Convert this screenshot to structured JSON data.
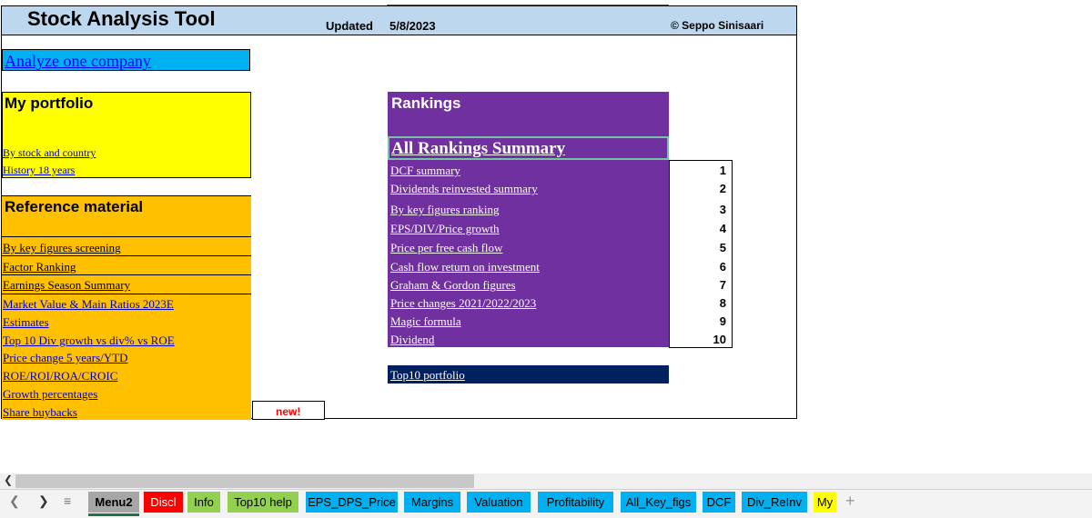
{
  "header": {
    "title": "Stock Analysis Tool",
    "updated_label": "Updated",
    "updated_date": "5/8/2023",
    "copyright": "© Seppo Sinisaari"
  },
  "analyze_link": "Analyze one company",
  "portfolio": {
    "title": "My portfolio",
    "links": [
      "By stock and country",
      "History 18 years"
    ]
  },
  "reference": {
    "title": "Reference material",
    "links": [
      "By key figures screening",
      "Factor Ranking",
      "Earnings Season Summary",
      "Market Value & Main Ratios 2023E",
      "Estimates",
      "Top 10 Div growth vs div% vs ROE",
      "Price change 5 years/YTD",
      "ROE/ROI/ROA/CROIC",
      "Growth  percentages",
      "Share buybacks"
    ],
    "new_label": "new!"
  },
  "rankings": {
    "title": "Rankings",
    "summary": "All Rankings Summary",
    "items": [
      {
        "label": "DCF summary",
        "num": "1"
      },
      {
        "label": "Dividends reinvested summary",
        "num": "2"
      },
      {
        "label": "By key figures ranking",
        "num": "3"
      },
      {
        "label": "EPS/DIV/Price growth",
        "num": "4"
      },
      {
        "label": "Price per free cash flow",
        "num": "5"
      },
      {
        "label": "Cash flow return on investment",
        "num": "6"
      },
      {
        "label": "Graham & Gordon figures",
        "num": "7"
      },
      {
        "label": "Price changes 2021/2022/2023",
        "num": "8"
      },
      {
        "label": "Magic formula",
        "num": "9"
      },
      {
        "label": "Dividend",
        "num": "10"
      }
    ],
    "top10": "Top10 portfolio"
  },
  "tabs": [
    {
      "label": "Menu2",
      "color": "#a6a6a6"
    },
    {
      "label": "Discl",
      "color": "#ff0000"
    },
    {
      "label": "Info",
      "color": "#92d050"
    },
    {
      "label": "Top10 help",
      "color": "#92d050"
    },
    {
      "label": "EPS_DPS_Price",
      "color": "#00b0f0"
    },
    {
      "label": "Margins",
      "color": "#00b0f0"
    },
    {
      "label": "Valuation",
      "color": "#00b0f0"
    },
    {
      "label": "Profitability",
      "color": "#00b0f0"
    },
    {
      "label": "All_Key_figs",
      "color": "#00b0f0"
    },
    {
      "label": "DCF",
      "color": "#00b0f0"
    },
    {
      "label": "Div_ReInv",
      "color": "#00b0f0"
    },
    {
      "label": "My",
      "color": "#ffff00"
    }
  ],
  "tabbar_icons": [
    "scroll-left-icon",
    "scroll-right-icon",
    "sheet-list-icon",
    "add-sheet-icon"
  ]
}
